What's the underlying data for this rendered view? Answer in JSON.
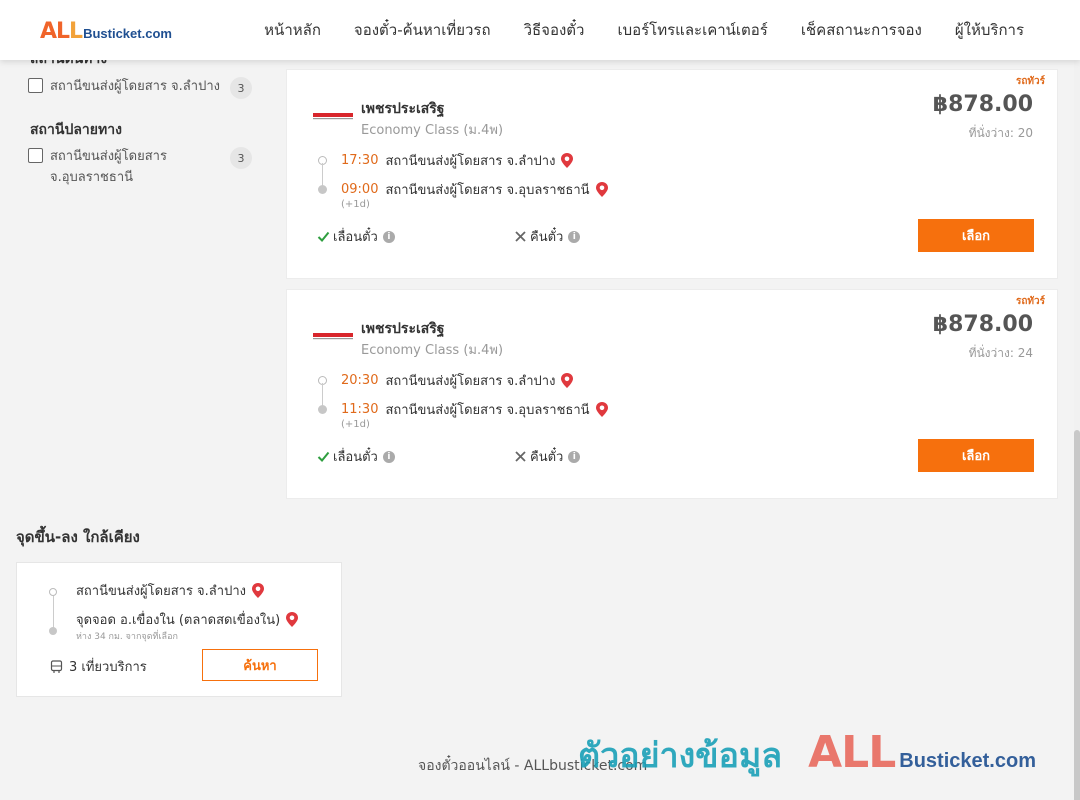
{
  "header": {
    "logo_all": "AL",
    "logo_ll": "L",
    "logo_rest": "Busticket.com",
    "nav": [
      "หน้าหลัก",
      "จองตั๋ว-ค้นหาเที่ยวรถ",
      "วิธีจองตั๋ว",
      "เบอร์โทรและเคาน์เตอร์",
      "เช็คสถานะการจอง",
      "ผู้ให้บริการ"
    ]
  },
  "sidebar": {
    "origin_title_clipped": "สถานีต้นทาง",
    "origin_filter": {
      "label": "สถานีขนส่งผู้โดยสาร จ.ลำปาง",
      "count": "3"
    },
    "destination_title": "สถานีปลายทาง",
    "destination_filter": {
      "label": "สถานีขนส่งผู้โดยสาร จ.อุบลราชธานี",
      "count": "3"
    }
  },
  "trips": [
    {
      "tag": "รถทัวร์",
      "operator": "เพชรประเสริฐ",
      "class": "Economy Class (ม.4พ)",
      "price": "฿878.00",
      "seats": "ที่นั่งว่าง: 20",
      "depart_time": "17:30",
      "depart_station": "สถานีขนส่งผู้โดยสาร จ.ลำปาง",
      "arrive_time": "09:00",
      "arrive_station": "สถานีขนส่งผู้โดยสาร จ.อุบลราชธานี",
      "next_day": "(+1d)",
      "policy_reschedule": "เลื่อนตั๋ว",
      "policy_refund": "คืนตั๋ว",
      "select_label": "เลือก"
    },
    {
      "tag": "รถทัวร์",
      "operator": "เพชรประเสริฐ",
      "class": "Economy Class (ม.4พ)",
      "price": "฿878.00",
      "seats": "ที่นั่งว่าง: 24",
      "depart_time": "20:30",
      "depart_station": "สถานีขนส่งผู้โดยสาร จ.ลำปาง",
      "arrive_time": "11:30",
      "arrive_station": "สถานีขนส่งผู้โดยสาร จ.อุบลราชธานี",
      "next_day": "(+1d)",
      "policy_reschedule": "เลื่อนตั๋ว",
      "policy_refund": "คืนตั๋ว",
      "select_label": "เลือก"
    }
  ],
  "nearby": {
    "title": "จุดขึ้น-ลง ใกล้เคียง",
    "from": "สถานีขนส่งผู้โดยสาร จ.ลำปาง",
    "to": "จุดจอด อ.เขื่องใน (ตลาดสดเขื่องใน)",
    "distance": "ห่าง 34 กม. จากจุดที่เลือก",
    "trips": "3 เที่ยวบริการ",
    "search_label": "ค้นหา"
  },
  "footer": {
    "text": "จองตั๋วออนไลน์ - ALLbusticket.com"
  },
  "watermark": {
    "thai": "ตัวอย่างข้อมูล",
    "all": "ALL",
    "rest": "Busticket.com"
  },
  "colors": {
    "accent": "#f6700d",
    "time": "#e06a1b",
    "pin": "#e0393e",
    "check": "#2e9e3f"
  }
}
